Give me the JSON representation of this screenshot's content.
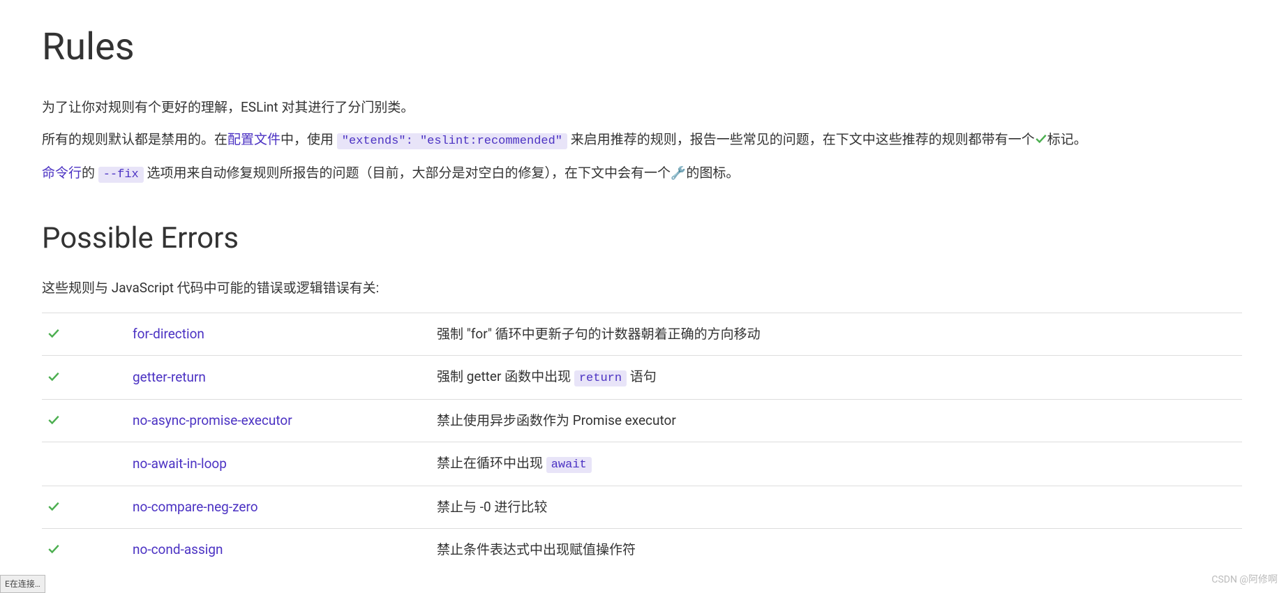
{
  "heading": "Rules",
  "intro_p1": "为了让你对规则有个更好的理解，ESLint 对其进行了分门别类。",
  "intro_p2_a": "所有的规则默认都是禁用的。在",
  "intro_p2_link": "配置文件",
  "intro_p2_b": "中，使用 ",
  "intro_p2_code": "\"extends\": \"eslint:recommended\"",
  "intro_p2_c": " 来启用推荐的规则，报告一些常见的问题，在下文中这些推荐的规则都带有一个",
  "intro_p2_d": "标记。",
  "intro_p3_link": "命令行",
  "intro_p3_a": "的 ",
  "intro_p3_code": "--fix",
  "intro_p3_b": " 选项用来自动修复规则所报告的问题（目前，大部分是对空白的修复），在下文中会有一个",
  "intro_p3_c": "的图标。",
  "section_h2": "Possible Errors",
  "section_intro": "这些规则与 JavaScript 代码中可能的错误或逻辑错误有关:",
  "rules": [
    {
      "recommended": true,
      "name": "for-direction",
      "desc_pre": "强制 \"for\" 循环中更新子句的计数器朝着正确的方向移动",
      "code": "",
      "desc_post": ""
    },
    {
      "recommended": true,
      "name": "getter-return",
      "desc_pre": "强制 getter 函数中出现 ",
      "code": "return",
      "desc_post": " 语句"
    },
    {
      "recommended": true,
      "name": "no-async-promise-executor",
      "desc_pre": "禁止使用异步函数作为 Promise executor",
      "code": "",
      "desc_post": ""
    },
    {
      "recommended": false,
      "name": "no-await-in-loop",
      "desc_pre": "禁止在循环中出现 ",
      "code": "await",
      "desc_post": ""
    },
    {
      "recommended": true,
      "name": "no-compare-neg-zero",
      "desc_pre": "禁止与 -0 进行比较",
      "code": "",
      "desc_post": ""
    },
    {
      "recommended": true,
      "name": "no-cond-assign",
      "desc_pre": "禁止条件表达式中出现赋值操作符",
      "code": "",
      "desc_post": ""
    }
  ],
  "status_text": "E在连接…",
  "watermark": "CSDN @阿修啊"
}
